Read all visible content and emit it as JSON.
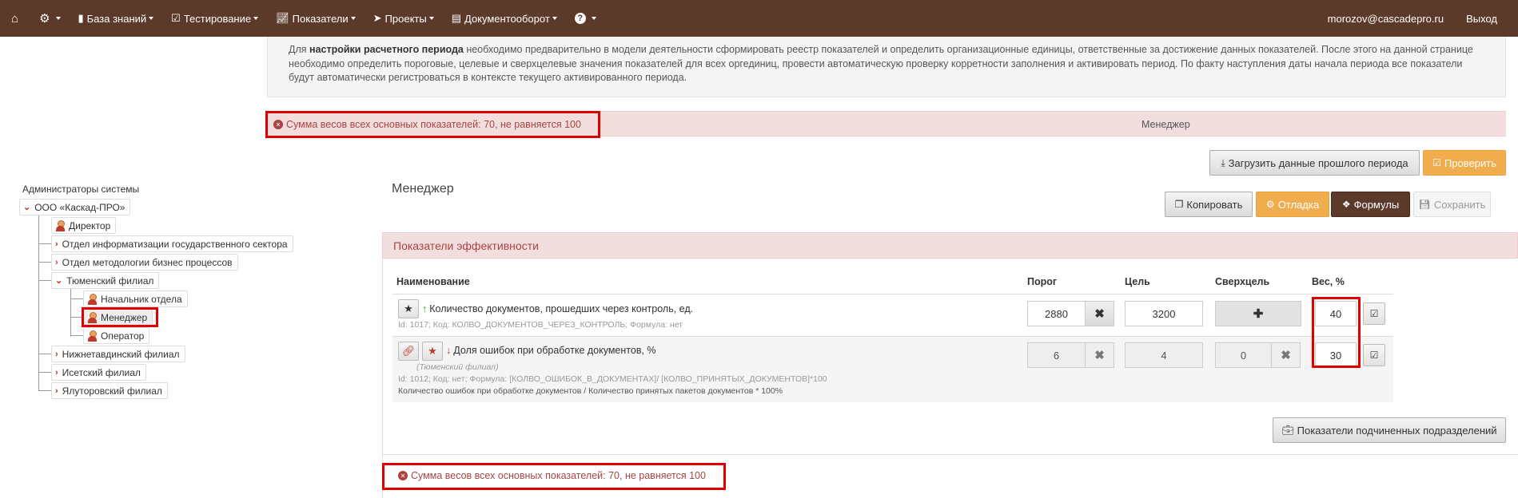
{
  "nav": {
    "items": [
      {
        "icon": "home-icon",
        "label": ""
      },
      {
        "icon": "gear-icon",
        "label": ""
      },
      {
        "icon": "book-icon",
        "label": "База знаний"
      },
      {
        "icon": "checkbox-icon",
        "label": "Тестирование"
      },
      {
        "icon": "chart-icon",
        "label": "Показатели"
      },
      {
        "icon": "paper-plane-icon",
        "label": "Проекты"
      },
      {
        "icon": "document-icon",
        "label": "Документооборот"
      },
      {
        "icon": "question-icon",
        "label": ""
      }
    ],
    "user_email": "morozov@cascadepro.ru",
    "logout": "Выход"
  },
  "info": {
    "prefix": "Для ",
    "bold": "настройки расчетного периода",
    "text": " необходимо предварительно в модели деятельности сформировать реестр показателей и определить организационные единицы, ответственные за достижение данных показателей. После этого на данной странице необходимо определить пороговые, целевые и сверхцелевые значения показателей для всех оргединиц, провести автоматическую проверку корретности заполнения и активировать период. По факту наступления даты начала периода все показатели будут автоматически регистроваться в контексте текущего активированного периода."
  },
  "alert": {
    "message": "Сумма весов всех основных показателей: 70, не равняется 100",
    "unit_name": "Менеджер"
  },
  "actions": {
    "load_previous": "Загрузить данные прошлого периода",
    "check": "Проверить",
    "copy": "Копировать",
    "debug": "Отладка",
    "formulas": "Формулы",
    "save": "Сохранить",
    "subordinate": "Показатели подчиненных подразделений"
  },
  "tree": {
    "admins": "Администраторы системы",
    "org": "ООО «Каскад-ПРО»",
    "director": "Директор",
    "dept1": "Отдел информатизации государственного сектора",
    "dept2": "Отдел методологии бизнес процессов",
    "tyumen": "Тюменский филиал",
    "head": "Начальник отдела",
    "manager": "Менеджер",
    "operator": "Оператор",
    "nizhnetavda": "Нижнетавдинский филиал",
    "isetsk": "Исетский филиал",
    "yalutorovsk": "Ялуторовский филиал"
  },
  "panel": {
    "title": "Менеджер",
    "heading": "Показатели эффективности",
    "columns": {
      "name": "Наименование",
      "threshold": "Порог",
      "target": "Цель",
      "over": "Сверхцель",
      "weight": "Вес, %"
    }
  },
  "rows": [
    {
      "name": "Количество документов, прошедших через контроль, ед.",
      "meta": "Id: 1017; Код: КОЛВО_ДОКУМЕНТОВ_ЧЕРЕЗ_КОНТРОЛЬ; Формула: нет",
      "threshold": "2880",
      "target": "3200",
      "over": "",
      "weight": "40"
    },
    {
      "name": "Доля ошибок при обработке документов, %",
      "branch": "(Тюменский филиал)",
      "meta": "Id: 1012; Код: нет; Формула: [КОЛВО_ОШИБОК_В_ДОКУМЕНТАХ]/ [КОЛВО_ПРИНЯТЫХ_ДОКУМЕНТОВ]*100",
      "description": "Количество ошибок при обработке документов / Количество принятых пакетов документов * 100%",
      "threshold": "6",
      "target": "4",
      "over": "0",
      "weight": "30"
    }
  ],
  "colors": {
    "nav_bg": "#5b3a29",
    "alert_bg": "#f2dede",
    "alert_text": "#a94442",
    "warning": "#f0ad4e",
    "highlight": "#e00000"
  }
}
